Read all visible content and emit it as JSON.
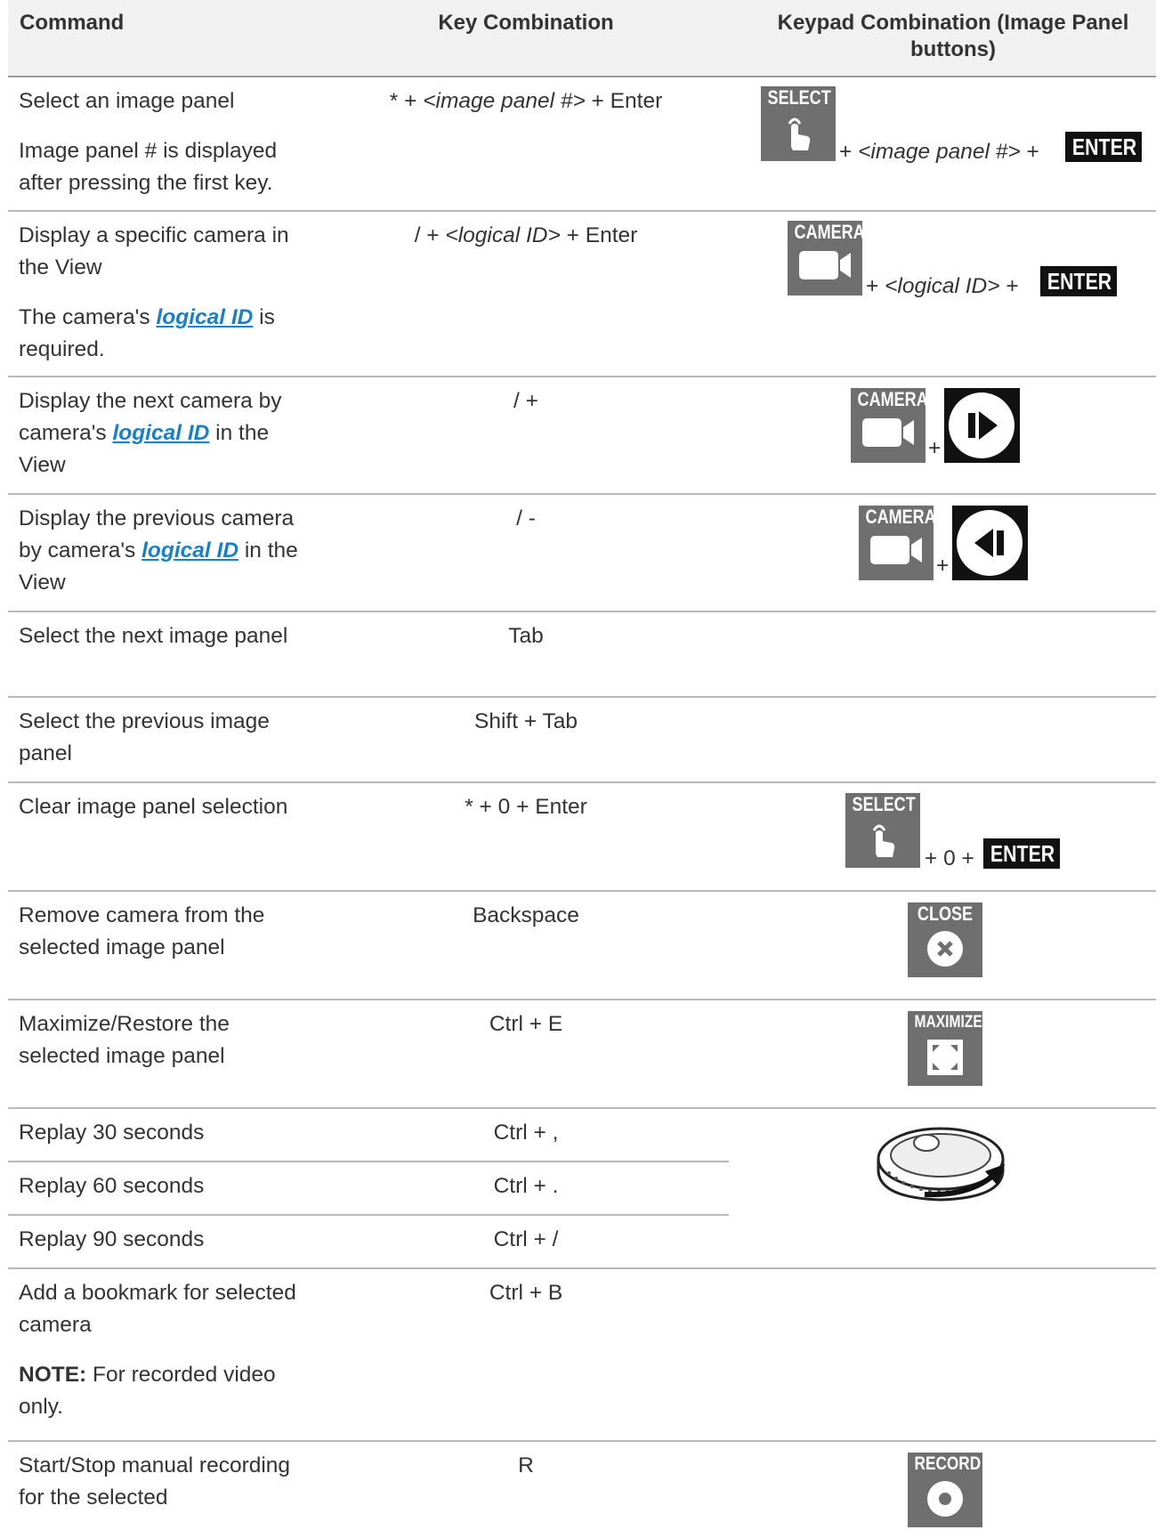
{
  "header": {
    "col1": "Command",
    "col2": "Key Combination",
    "col3": "Keypad Combination (Image Panel buttons)"
  },
  "link_text": "logical ID",
  "labels": {
    "select": "SELECT",
    "camera": "CAMERA",
    "enter": "ENTER",
    "close": "CLOSE",
    "maximize": "MAXIMIZE",
    "record": "RECORD"
  },
  "rows": {
    "select_panel": {
      "cmd": "Select an image panel",
      "note": "Image panel # is displayed after pressing the first key.",
      "key_a": "* + ",
      "key_it": "<image panel #>",
      "key_b": " + Enter",
      "kp_a": "+ ",
      "kp_it": "<image panel #>",
      "kp_b": " +"
    },
    "display_camera": {
      "cmd": "Display a specific camera in the View",
      "note_a": "The camera's ",
      "note_b": " is required.",
      "key_a": "/ + ",
      "key_it": "<logical ID>",
      "key_b": " + Enter",
      "kp_a": "+ ",
      "kp_it": "<logical ID>",
      "kp_b": " +"
    },
    "next_camera": {
      "cmd_a": "Display the next camera by camera's ",
      "cmd_b": " in the View",
      "key": "/ +",
      "plus": "+"
    },
    "prev_camera": {
      "cmd_a": "Display the previous camera by camera's ",
      "cmd_b": " in the View",
      "key": "/ -",
      "plus": "+"
    },
    "next_panel": {
      "cmd": "Select the next image panel",
      "key": "Tab"
    },
    "prev_panel": {
      "cmd": "Select the previous image panel",
      "key": "Shift + Tab"
    },
    "clear_panel": {
      "cmd": "Clear image panel selection",
      "key": "* + 0 + Enter",
      "kp": "+ 0 +"
    },
    "remove_camera": {
      "cmd": "Remove camera from the selected image panel",
      "key": "Backspace"
    },
    "maximize": {
      "cmd": "Maximize/Restore the selected image panel",
      "key": "Ctrl + E"
    },
    "replay30": {
      "cmd": "Replay 30 seconds",
      "key": "Ctrl + ,"
    },
    "replay60": {
      "cmd": "Replay 60 seconds",
      "key": "Ctrl + ."
    },
    "replay90": {
      "cmd": "Replay 90 seconds",
      "key": "Ctrl + /"
    },
    "bookmark": {
      "cmd": "Add a bookmark for selected camera",
      "note_b": "NOTE:",
      "note": " For recorded video only.",
      "key": "Ctrl + B"
    },
    "record": {
      "cmd": "Start/Stop manual recording for the selected",
      "key": "R"
    }
  }
}
